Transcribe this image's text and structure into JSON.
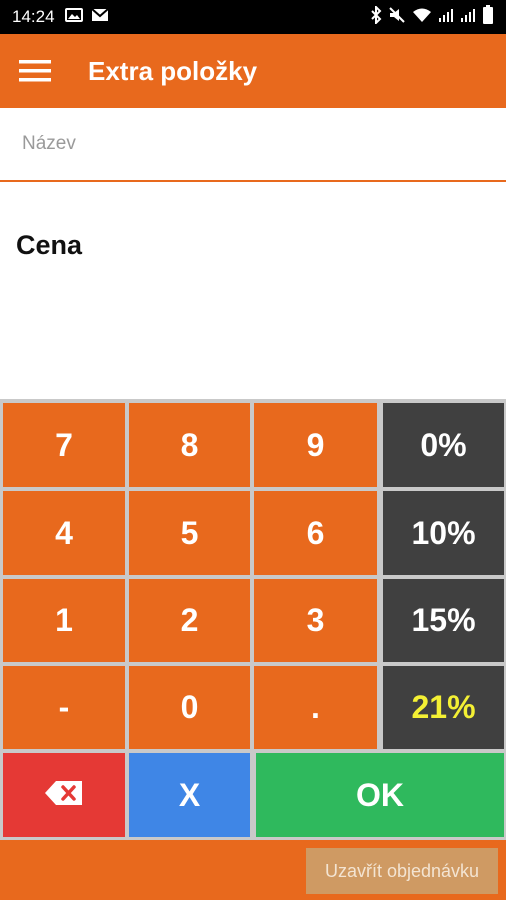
{
  "status_bar": {
    "time": "14:24",
    "left_icons": [
      "image-icon",
      "mail-icon"
    ],
    "right_icons": [
      "bluetooth-icon",
      "mute-icon",
      "wifi-icon",
      "signal-icon",
      "signal-icon",
      "battery-icon"
    ]
  },
  "app_bar": {
    "title": "Extra položky",
    "menu_icon": "hamburger-menu-icon"
  },
  "name_field": {
    "placeholder": "Název",
    "value": ""
  },
  "price": {
    "label": "Cena"
  },
  "keypad": {
    "digits": [
      [
        "7",
        "8",
        "9"
      ],
      [
        "4",
        "5",
        "6"
      ],
      [
        "1",
        "2",
        "3"
      ],
      [
        "-",
        "0",
        "."
      ]
    ],
    "vat_keys": [
      "0%",
      "10%",
      "15%",
      "21%"
    ],
    "selected_vat": "21%",
    "backspace_icon": "backspace-icon",
    "clear_label": "X",
    "ok_label": "OK"
  },
  "bottom_bar": {
    "close_order_label": "Uzavřít objednávku"
  },
  "colors": {
    "accent": "#e8691d",
    "dark_key": "#404040",
    "selected_vat_text": "#f4f034",
    "backspace": "#e53935",
    "clear": "#3f86e6",
    "ok": "#2fb95d",
    "close_order_bg": "#cf9a63",
    "close_order_text": "#f3e4d2"
  }
}
